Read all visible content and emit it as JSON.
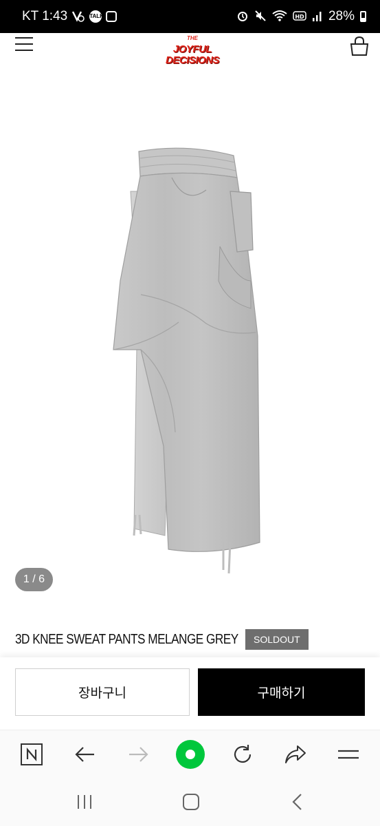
{
  "status_bar": {
    "carrier_time": "KT 1:43",
    "talk_badge": "TALK",
    "battery": "28%",
    "icons": [
      "vpn-icon",
      "talk-icon",
      "instagram-icon",
      "alarm-icon",
      "mute-icon",
      "wifi-icon",
      "hd-icon",
      "signal-icon",
      "battery-icon"
    ]
  },
  "header": {
    "logo_top": "THE",
    "logo_line1": "JOYFUL",
    "logo_line2": "DECISIONS",
    "logo_color": "#e0261c"
  },
  "product": {
    "image_pager": "1 / 6",
    "title": "3D KNEE SWEAT PANTS MELANGE GREY",
    "status_badge": "SOLDOUT"
  },
  "actions": {
    "cart_label": "장바구니",
    "buy_label": "구매하기"
  },
  "browser_toolbar": {
    "items": [
      "naver-icon",
      "back-arrow-icon",
      "forward-arrow-icon",
      "green-dot-icon",
      "refresh-icon",
      "share-icon",
      "menu-icon"
    ],
    "accent": "#00c73c"
  },
  "android_nav": {
    "items": [
      "recent-apps-icon",
      "home-icon",
      "back-icon"
    ]
  }
}
